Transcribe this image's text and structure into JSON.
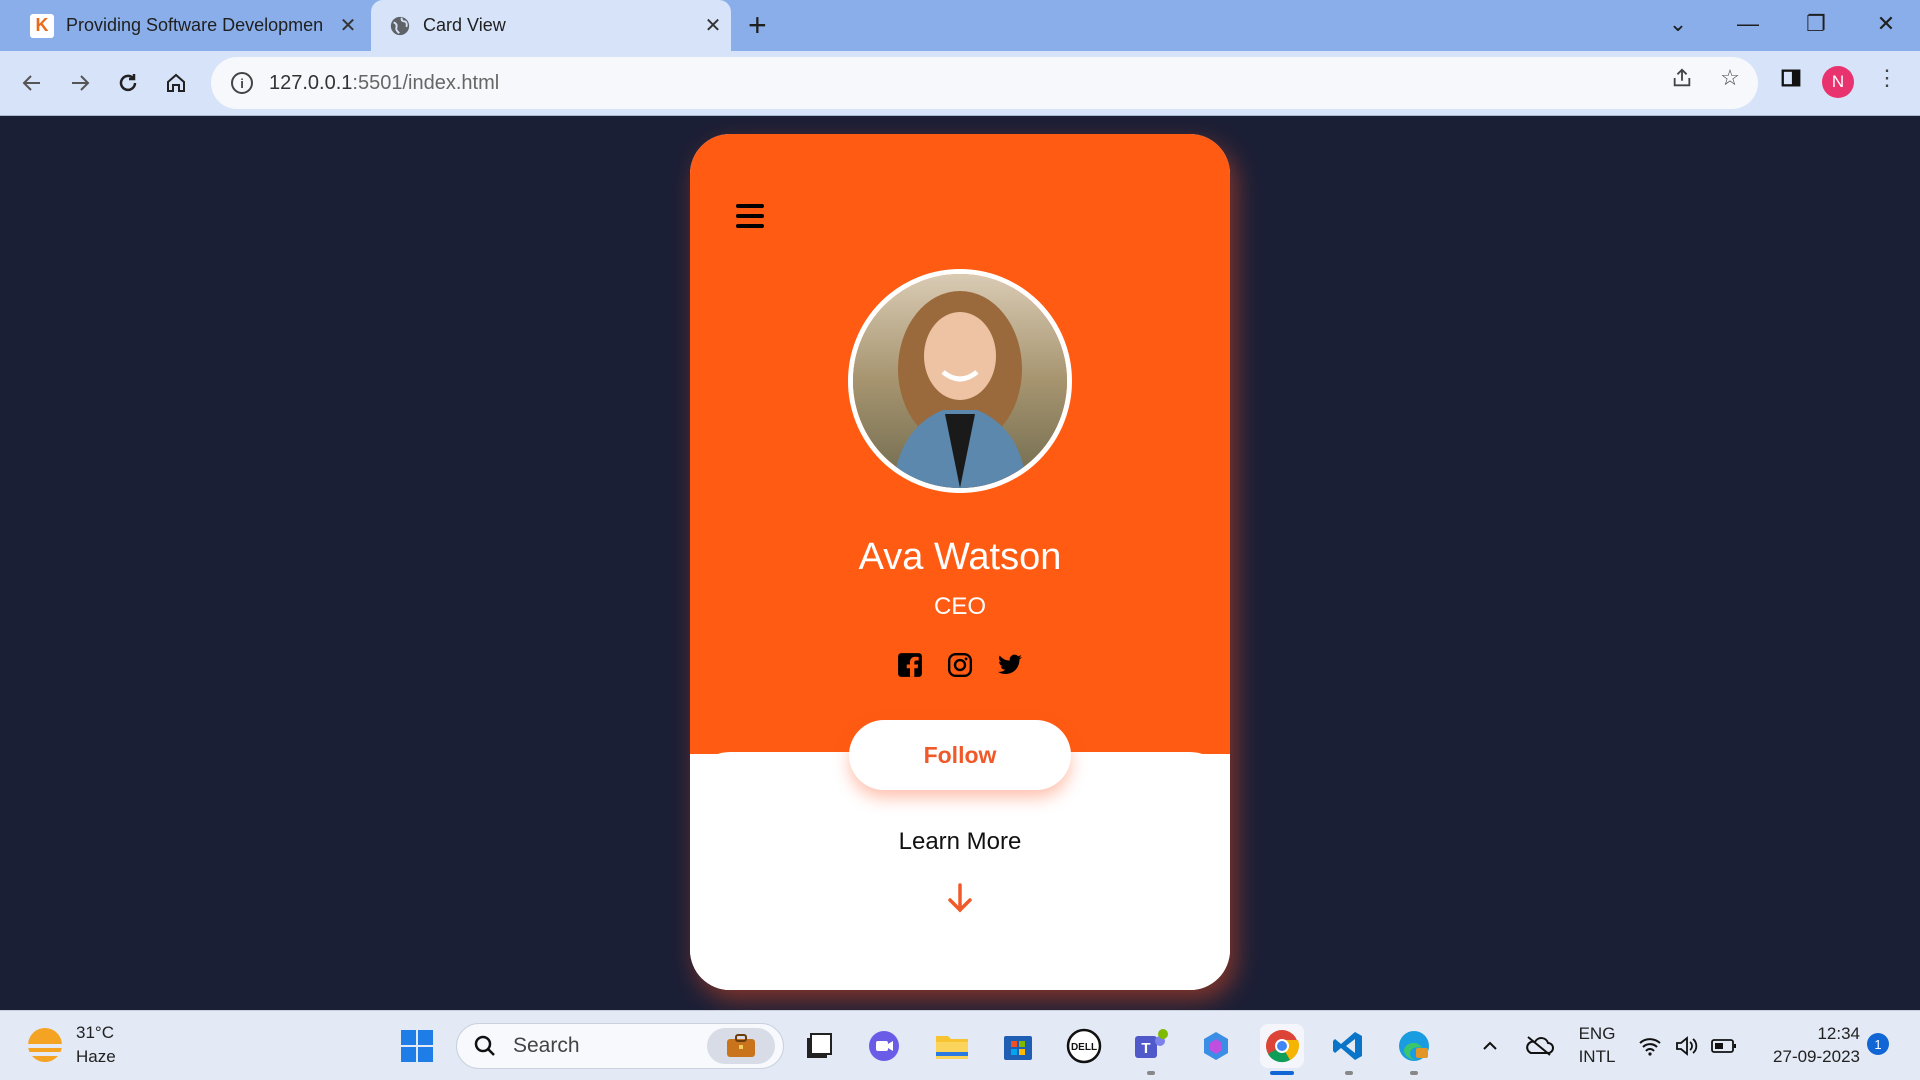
{
  "browser": {
    "tabs": [
      {
        "title": "Providing Software Developmen",
        "icon": "k-logo-icon",
        "active": false
      },
      {
        "title": "Card View",
        "icon": "globe-icon",
        "active": true
      }
    ],
    "url_host": "127.0.0.1",
    "url_rest": ":5501/index.html",
    "profile_initial": "N"
  },
  "card": {
    "name": "Ava Watson",
    "role": "CEO",
    "socials": [
      "facebook-icon",
      "instagram-icon",
      "twitter-icon"
    ],
    "follow_label": "Follow",
    "learn_more_label": "Learn More",
    "accent": "#ff5b12",
    "page_background": "#1b1f36"
  },
  "taskbar": {
    "weather_temp": "31°C",
    "weather_desc": "Haze",
    "search_label": "Search",
    "lang_top": "ENG",
    "lang_bottom": "INTL",
    "time": "12:34",
    "date": "27-09-2023",
    "notification_count": "1"
  }
}
